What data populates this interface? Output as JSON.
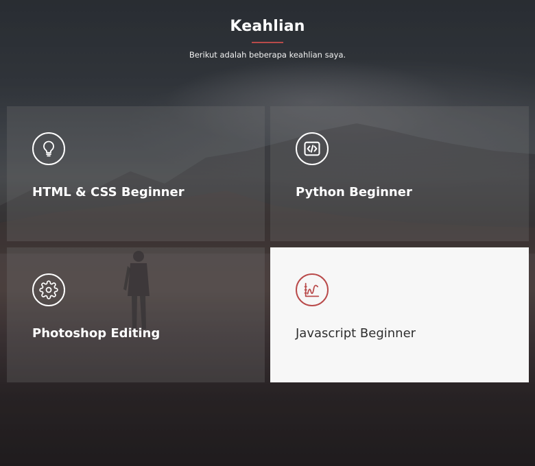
{
  "section": {
    "title": "Keahlian",
    "subtitle": "Berikut adalah beberapa keahlian saya."
  },
  "skills": [
    {
      "label": "HTML & CSS Beginner",
      "icon": "lightbulb-icon"
    },
    {
      "label": "Python Beginner",
      "icon": "code-icon"
    },
    {
      "label": "Photoshop Editing",
      "icon": "gear-icon"
    },
    {
      "label": "Javascript Beginner",
      "icon": "line-chart-icon"
    }
  ],
  "colors": {
    "accent": "#b94a4a",
    "card_overlay": "rgba(120,120,120,0.28)",
    "active_card": "#f7f7f7"
  }
}
